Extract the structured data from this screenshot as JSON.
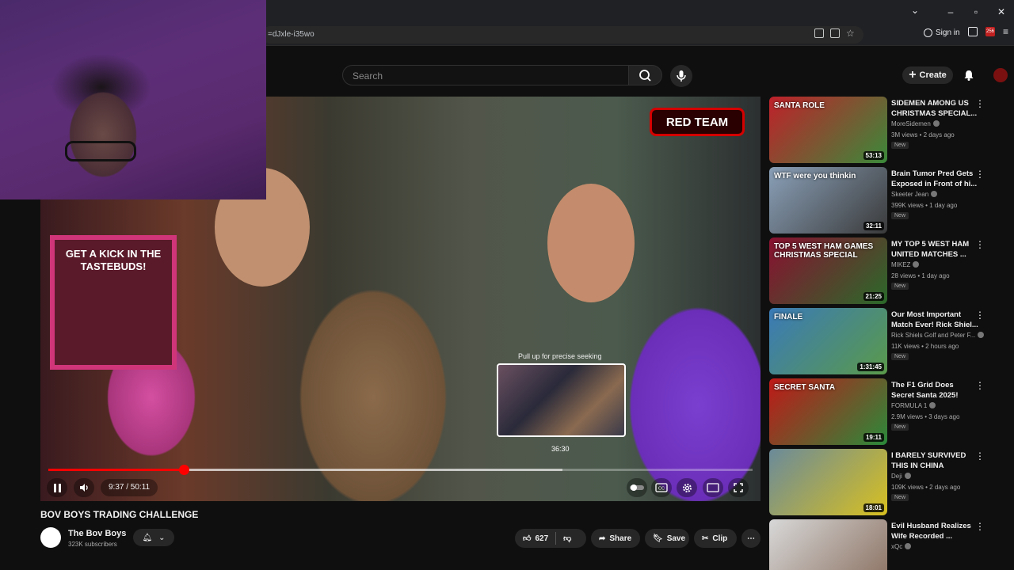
{
  "browser": {
    "url": "=dJxle-i35wo",
    "signin_label": "Sign in",
    "ext_badge": "256"
  },
  "header": {
    "search_placeholder": "Search",
    "create_label": "Create"
  },
  "player": {
    "overlay_badge": "RED TEAM",
    "sign_text": "GET A KICK IN THE TASTEBUDS!",
    "pull_hint": "Pull up for precise seeking",
    "preview_time": "36:30",
    "time_current": "9:37",
    "time_total": "50:11",
    "time_display": "9:37 / 50:11",
    "progress_fraction": 0.192,
    "hover_fraction": 0.73
  },
  "video": {
    "title": "BOV BOYS TRADING CHALLENGE",
    "channel": "The Bov Boys",
    "subscribers": "323K subscribers",
    "likes": "627",
    "share_label": "Share",
    "save_label": "Save",
    "clip_label": "Clip"
  },
  "recommendations": [
    {
      "title": "SIDEMEN AMONG US CHRISTMAS SPECIAL...",
      "channel": "MoreSidemen",
      "meta": "3M views • 2 days ago",
      "badge": "New",
      "duration": "53:13",
      "thumb_text": "SANTA ROLE",
      "colors": [
        "#c0202a",
        "#3a8a3a"
      ]
    },
    {
      "title": "Brain Tumor Pred Gets Exposed in Front of hi...",
      "channel": "Skeeter Jean",
      "meta": "399K views • 1 day ago",
      "badge": "New",
      "duration": "32:11",
      "thumb_text": "WTF were you thinkin",
      "colors": [
        "#8aa0b8",
        "#3a3a3a"
      ]
    },
    {
      "title": "MY TOP 5 WEST HAM UNITED MATCHES ...",
      "channel": "MIKEZ",
      "meta": "28 views • 1 day ago",
      "badge": "New",
      "duration": "21:25",
      "thumb_text": "TOP 5 WEST HAM GAMES CHRISTMAS SPECIAL",
      "colors": [
        "#8a1030",
        "#2a6a2a"
      ]
    },
    {
      "title": "Our Most Important Match Ever! Rick Shiel...",
      "channel": "Rick Shiels Golf and Peter F...",
      "meta": "11K views • 2 hours ago",
      "badge": "New",
      "duration": "1:31:45",
      "thumb_text": "FINALE",
      "colors": [
        "#3a7ab8",
        "#5a9a4a"
      ]
    },
    {
      "title": "The F1 Grid Does Secret Santa 2025!",
      "channel": "FORMULA 1",
      "meta": "2.9M views • 3 days ago",
      "badge": "New",
      "duration": "19:11",
      "thumb_text": "SECRET SANTA",
      "colors": [
        "#c01818",
        "#2a8a3a"
      ]
    },
    {
      "title": "I BARELY SURVIVED THIS IN CHINA",
      "channel": "Deji",
      "meta": "109K views • 2 days ago",
      "badge": "New",
      "duration": "18:01",
      "thumb_text": "",
      "colors": [
        "#6a8a9a",
        "#d8c020"
      ]
    },
    {
      "title": "Evil Husband Realizes Wife Recorded ...",
      "channel": "xQc",
      "meta": "",
      "badge": "",
      "duration": "",
      "thumb_text": "",
      "colors": [
        "#d8d8d8",
        "#8a7060"
      ]
    }
  ],
  "colors": {
    "accent": "#ff0000",
    "background": "#0f0f0f",
    "chip": "#272727"
  }
}
